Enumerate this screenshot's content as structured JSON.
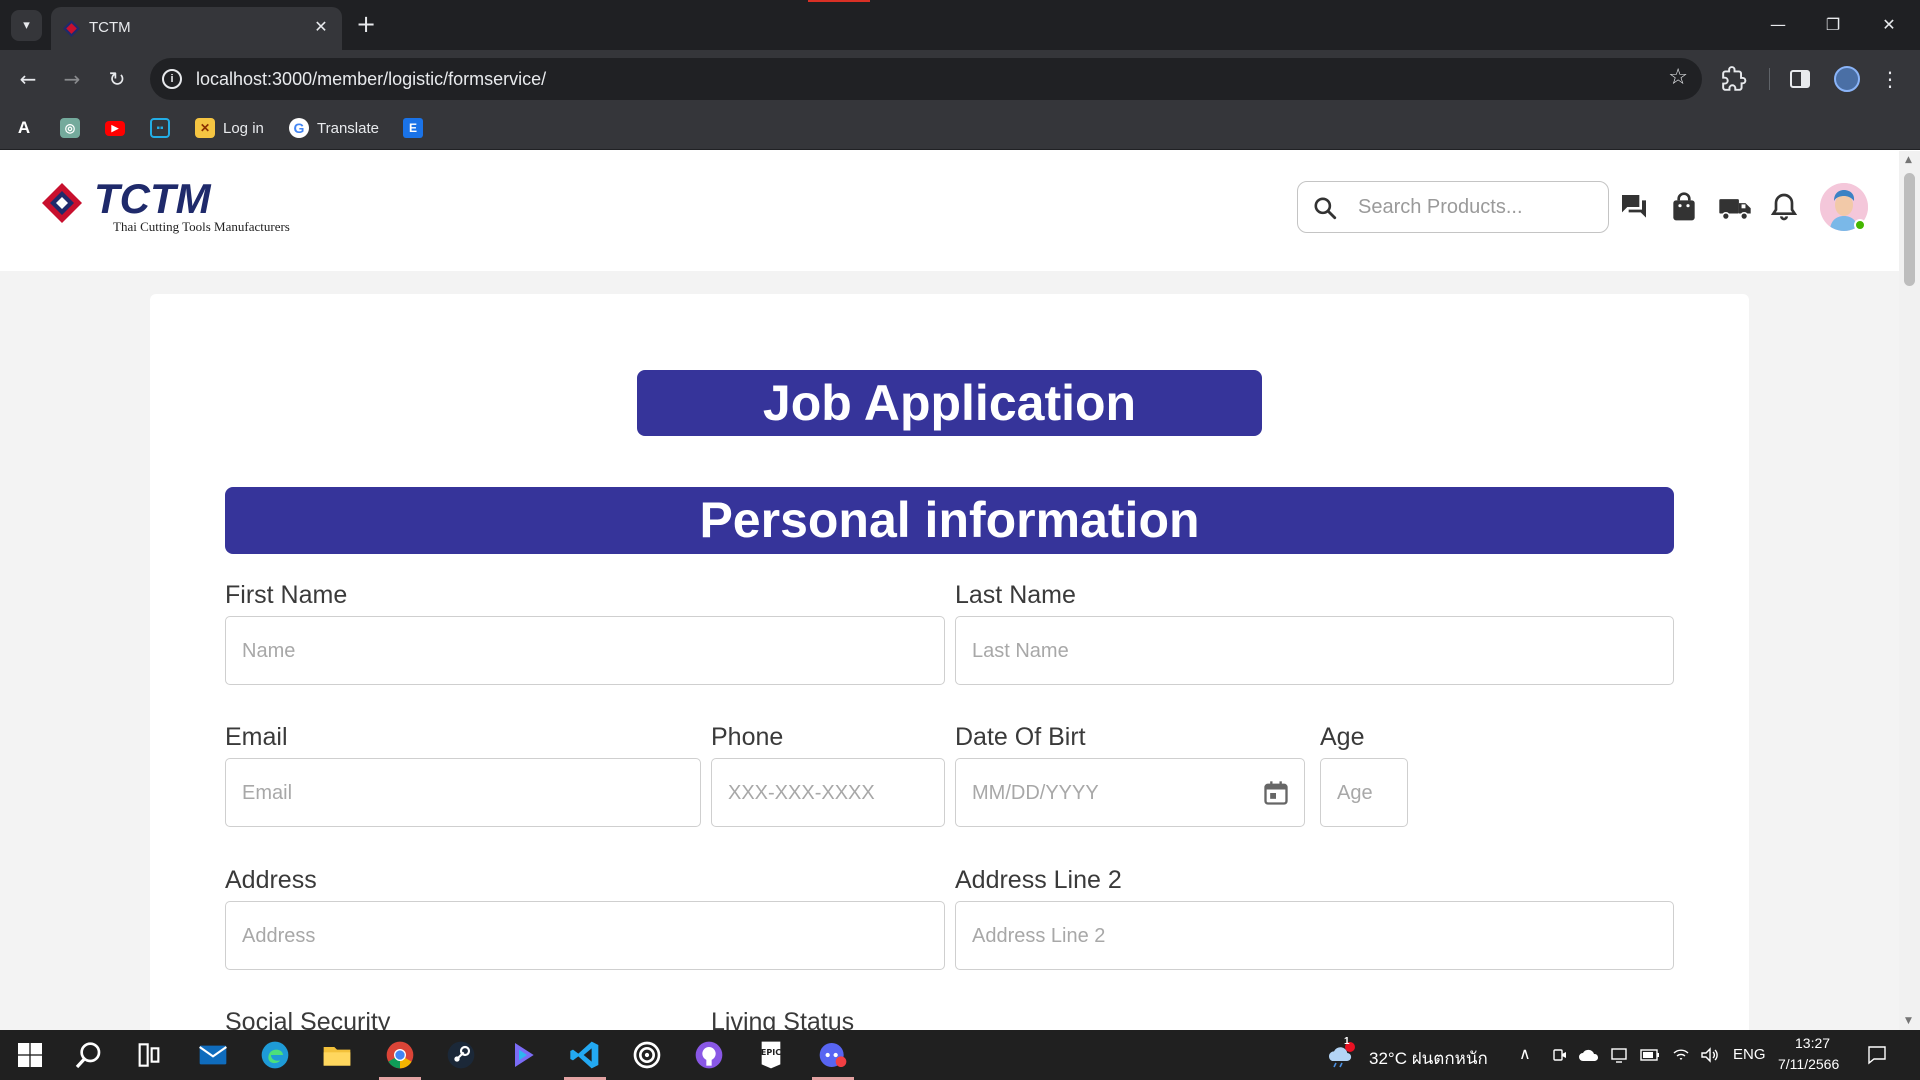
{
  "browser": {
    "tab_title": "TCTM",
    "url": "localhost:3000/member/logistic/formservice/",
    "bookmarks": [
      {
        "label": "",
        "icon": "a-letter-icon"
      },
      {
        "label": "",
        "icon": "chatgpt-icon"
      },
      {
        "label": "",
        "icon": "youtube-icon"
      },
      {
        "label": "",
        "icon": "bilibili-icon"
      },
      {
        "label": "Log in",
        "icon": "login-site-icon"
      },
      {
        "label": "Translate",
        "icon": "google-icon"
      },
      {
        "label": "",
        "icon": "e-letter-icon"
      }
    ]
  },
  "header": {
    "logo_text": "TCTM",
    "logo_subtitle": "Thai Cutting Tools Manufacturers",
    "search_placeholder": "Search Products...",
    "icons": [
      "chat-icon",
      "shopping-bag-icon",
      "truck-icon",
      "bell-icon"
    ]
  },
  "form": {
    "title": "Job Application",
    "section_title": "Personal information",
    "fields": {
      "first_name": {
        "label": "First Name",
        "placeholder": "Name"
      },
      "last_name": {
        "label": "Last Name",
        "placeholder": "Last Name"
      },
      "email": {
        "label": "Email",
        "placeholder": "Email"
      },
      "phone": {
        "label": "Phone",
        "placeholder": "XXX-XXX-XXXX"
      },
      "dob": {
        "label": "Date Of Birt",
        "placeholder": "MM/DD/YYYY"
      },
      "age": {
        "label": "Age",
        "placeholder": "Age"
      },
      "address": {
        "label": "Address",
        "placeholder": "Address"
      },
      "address2": {
        "label": "Address Line 2",
        "placeholder": "Address Line 2"
      },
      "social_security": {
        "label": "Social Security"
      },
      "living_status": {
        "label": "Living Status"
      }
    }
  },
  "taskbar": {
    "weather": "32°C ฝนตกหนัก",
    "weather_badge": "1",
    "language": "ENG",
    "time": "13:27",
    "date": "7/11/2566"
  },
  "colors": {
    "accent": "#36349a",
    "brand_red": "#c8102e",
    "brand_navy": "#1f2a6b"
  }
}
